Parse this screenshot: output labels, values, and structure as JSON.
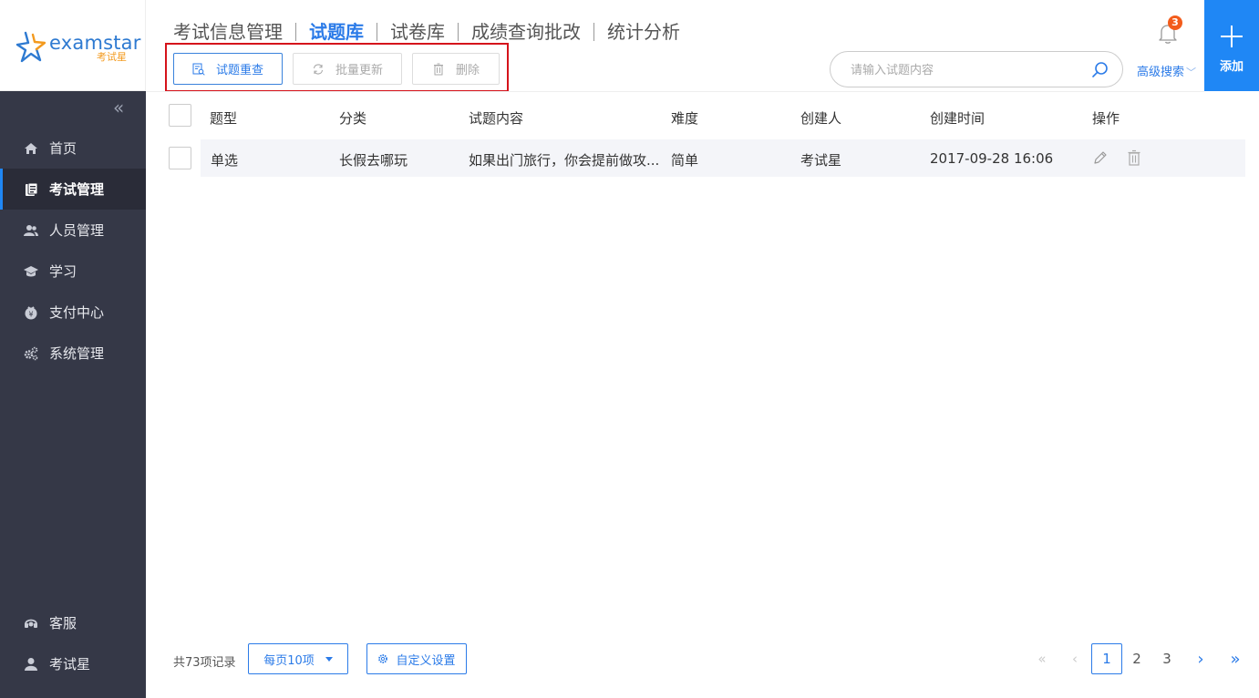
{
  "brand": {
    "name_en_prefix": "exam",
    "name_en_suffix": "star",
    "name_cn": "考试星",
    "primary_color": "#1f87f5",
    "highlight_color": "#d5131b"
  },
  "sidebar": {
    "items": [
      {
        "label": "首页",
        "icon": "home-icon"
      },
      {
        "label": "考试管理",
        "icon": "document-icon",
        "active": true
      },
      {
        "label": "人员管理",
        "icon": "users-icon"
      },
      {
        "label": "学习",
        "icon": "graduation-cap-icon"
      },
      {
        "label": "支付中心",
        "icon": "payment-icon"
      },
      {
        "label": "系统管理",
        "icon": "gears-icon"
      }
    ],
    "bottom": [
      {
        "label": "客服",
        "icon": "headset-icon"
      },
      {
        "label": "考试星",
        "icon": "user-icon"
      }
    ]
  },
  "header": {
    "tabs": [
      {
        "label": "考试信息管理"
      },
      {
        "label": "试题库",
        "active": true
      },
      {
        "label": "试卷库"
      },
      {
        "label": "成绩查询批改"
      },
      {
        "label": "统计分析"
      }
    ],
    "notification_count": "3",
    "add_label": "添加"
  },
  "toolbar": {
    "check_label": "试题重查",
    "batch_update_label": "批量更新",
    "delete_label": "删除"
  },
  "search": {
    "placeholder": "请输入试题内容",
    "value": "",
    "advanced_label": "高级搜索"
  },
  "table": {
    "headers": [
      "题型",
      "分类",
      "试题内容",
      "难度",
      "创建人",
      "创建时间",
      "操作"
    ],
    "rows": [
      {
        "type": "单选",
        "category": "长假去哪玩",
        "content": "如果出门旅行，你会提前做攻...",
        "difficulty": "简单",
        "creator": "考试星",
        "created": "2017-09-28 16:06"
      }
    ]
  },
  "footer": {
    "total": "共73项记录",
    "page_size": "每页10项",
    "custom_settings": "自定义设置",
    "pages": [
      "1",
      "2",
      "3"
    ],
    "current_page": "1"
  }
}
